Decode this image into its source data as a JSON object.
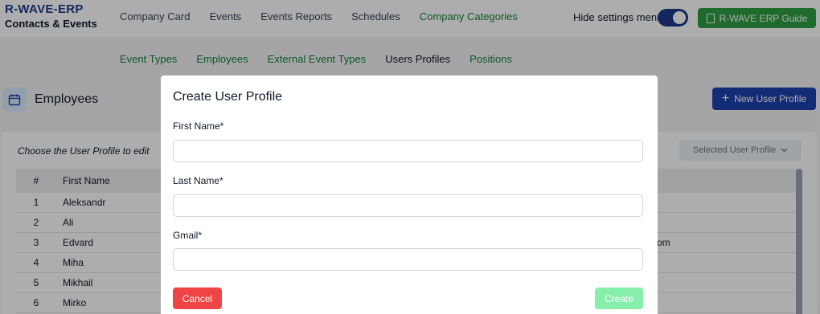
{
  "brand": {
    "title": "R-WAVE-ERP",
    "subtitle": "Contacts & Events"
  },
  "topnav": [
    "Company Card",
    "Events",
    "Events Reports",
    "Schedules",
    "Company Categories"
  ],
  "topnav_active": "Company Categories",
  "hide_settings_label": "Hide settings menu",
  "guide_button": "R-WAVE ERP Guide",
  "subnav": [
    "Event Types",
    "Employees",
    "External Event Types",
    "Users Profiles",
    "Positions"
  ],
  "subnav_active": "Users Profiles",
  "page_title": "Employees",
  "new_button": "New User Profile",
  "choose_label": "Choose the User Profile to edit",
  "selected_profile_placeholder": "Selected User Profile",
  "table": {
    "headers": {
      "num": "#",
      "first_name": "First Name"
    },
    "rows": [
      {
        "num": "1",
        "first": "Aleksandr",
        "rest": ""
      },
      {
        "num": "2",
        "first": "Ali",
        "rest": ""
      },
      {
        "num": "3",
        "first": "Edvard",
        "rest": "com"
      },
      {
        "num": "4",
        "first": "Miha",
        "rest": ""
      },
      {
        "num": "5",
        "first": "Mikhail",
        "rest": ""
      },
      {
        "num": "6",
        "first": "Mirko",
        "rest": ""
      }
    ]
  },
  "modal": {
    "title": "Create User Profile",
    "fields": [
      {
        "label": "First Name*",
        "value": ""
      },
      {
        "label": "Last Name*",
        "value": ""
      },
      {
        "label": "Gmail*",
        "value": ""
      }
    ],
    "cancel": "Cancel",
    "create": "Create"
  },
  "colors": {
    "brand": "#1e3a8a",
    "accent_green": "#15803d",
    "guide_button": "#2f9e44",
    "primary": "#1e40af",
    "danger": "#ef4444",
    "create_disabled": "#86efac"
  }
}
